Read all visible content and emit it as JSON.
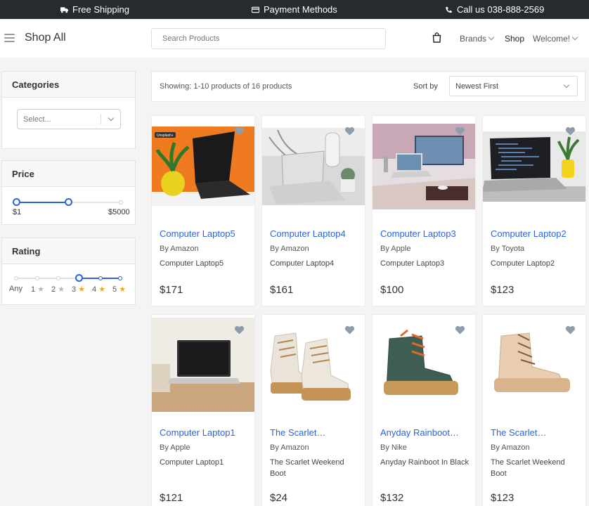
{
  "topbar": {
    "shipping": "Free Shipping",
    "payment": "Payment Methods",
    "call": "Call us 038-888-2569"
  },
  "header": {
    "title": "Shop All",
    "search_placeholder": "Search Products",
    "nav": {
      "brands": "Brands",
      "shop": "Shop",
      "welcome": "Welcome!"
    }
  },
  "sidebar": {
    "categories": {
      "title": "Categories",
      "select_placeholder": "Select..."
    },
    "price": {
      "title": "Price",
      "min_label": "$1",
      "max_label": "$5000"
    },
    "rating": {
      "title": "Rating",
      "options": [
        "Any",
        "1",
        "2",
        "3",
        "4",
        "5"
      ],
      "selected": "3"
    }
  },
  "results": {
    "showing_label": "Showing:",
    "showing_text": "1-10 products of 16 products",
    "sort_label": "Sort by",
    "sort_value": "Newest First"
  },
  "products": [
    {
      "title": "Computer Laptop5",
      "by": "By",
      "brand": "Amazon",
      "desc": "Computer Laptop5",
      "price": "$171",
      "badge": "Unsplash+"
    },
    {
      "title": "Computer Laptop4",
      "by": "By",
      "brand": "Amazon",
      "desc": "Computer Laptop4",
      "price": "$161"
    },
    {
      "title": "Computer Laptop3",
      "by": "By",
      "brand": "Apple",
      "desc": "Computer Laptop3",
      "price": "$100"
    },
    {
      "title": "Computer Laptop2",
      "by": "By",
      "brand": "Toyota",
      "desc": "Computer Laptop2",
      "price": "$123"
    },
    {
      "title": "Computer Laptop1",
      "by": "By",
      "brand": "Apple",
      "desc": "Computer Laptop1",
      "price": "$121"
    },
    {
      "title": "The Scarlet…",
      "by": "By",
      "brand": "Amazon",
      "desc": "The Scarlet Weekend Boot",
      "price": "$24"
    },
    {
      "title": "Anyday Rainboot…",
      "by": "By",
      "brand": "Nike",
      "desc": "Anyday Rainboot In Black",
      "price": "$132"
    },
    {
      "title": "The Scarlet…",
      "by": "By",
      "brand": "Amazon",
      "desc": "The Scarlet Weekend Boot",
      "price": "$123"
    }
  ],
  "colors": {
    "accent": "#2b64e0",
    "topbar": "#272b2f",
    "star": "#f2a61f"
  }
}
